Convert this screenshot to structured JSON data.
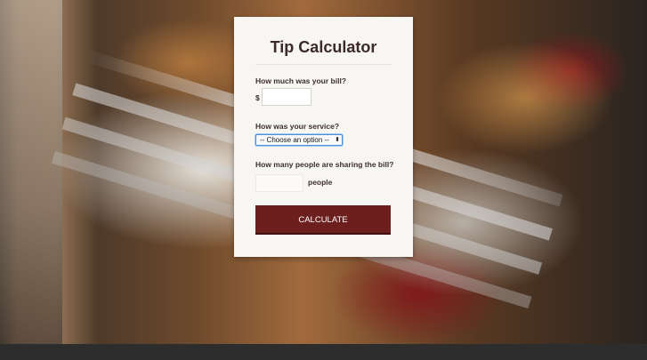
{
  "card": {
    "title": "Tip Calculator",
    "bill": {
      "label": "How much was your bill?",
      "currency_symbol": "$",
      "value": "",
      "placeholder": ""
    },
    "service": {
      "label": "How was your service?",
      "selected": "-- Choose an option --",
      "arrow": "⬍"
    },
    "people": {
      "label": "How many people are sharing the bill?",
      "value": "",
      "placeholder": "",
      "unit": "people"
    },
    "calculate_label": "CALCULATE"
  },
  "colors": {
    "button": "#6d1f1e",
    "card_background": "#f7f6f2",
    "title_text": "#3b2a27",
    "footer_bar": "#2d2d2d"
  }
}
